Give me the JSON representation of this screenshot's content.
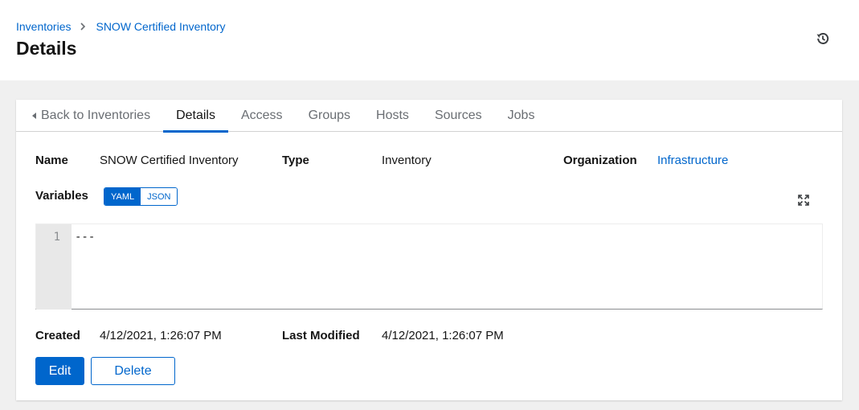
{
  "breadcrumb": {
    "parent": "Inventories",
    "current": "SNOW Certified Inventory"
  },
  "page_title": "Details",
  "icons": {
    "history": "history-icon",
    "expand": "expand-icon",
    "back": "caret-left-icon",
    "separator": "chevron-right-icon"
  },
  "tabs": [
    {
      "label": "Back to Inventories"
    },
    {
      "label": "Details"
    },
    {
      "label": "Access"
    },
    {
      "label": "Groups"
    },
    {
      "label": "Hosts"
    },
    {
      "label": "Sources"
    },
    {
      "label": "Jobs"
    }
  ],
  "details": {
    "name_label": "Name",
    "name_value": "SNOW Certified Inventory",
    "type_label": "Type",
    "type_value": "Inventory",
    "org_label": "Organization",
    "org_value": "Infrastructure",
    "variables_label": "Variables",
    "toggle_yaml": "YAML",
    "toggle_json": "JSON",
    "editor_line_number": "1",
    "editor_content": "---",
    "created_label": "Created",
    "created_value": "4/12/2021, 1:26:07 PM",
    "modified_label": "Last Modified",
    "modified_value": "4/12/2021, 1:26:07 PM"
  },
  "actions": {
    "edit": "Edit",
    "delete": "Delete"
  },
  "colors": {
    "accent": "#0066cc",
    "text": "#151515",
    "muted": "#6a6e73",
    "background": "#f0f0f0"
  }
}
